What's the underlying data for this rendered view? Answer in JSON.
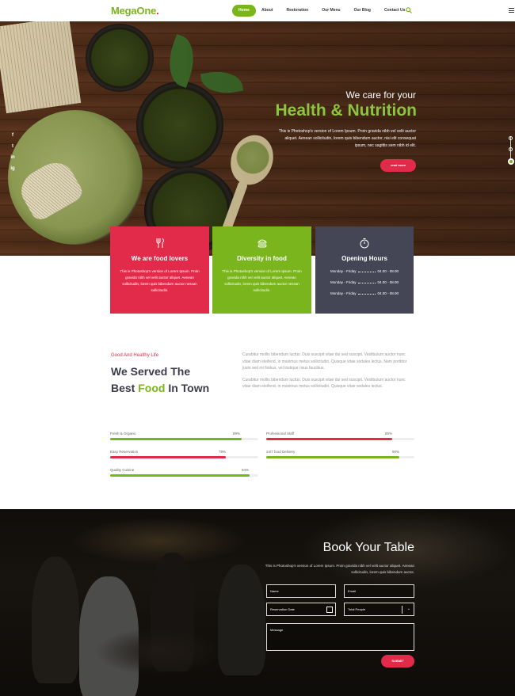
{
  "nav": {
    "logo": "MegaOne",
    "logo_dot": ".",
    "items": [
      "Home",
      "About",
      "Restoration",
      "Our Menu",
      "Our Blog",
      "Contact Us"
    ]
  },
  "hero": {
    "subtitle": "We care for your",
    "title": "Health & Nutrition",
    "description": "This is Photoshop's version of Lorem Ipsum. Proin gravida nibh vel velit auctor aliquet. Aenean sollicitudin, lorem quis bibendum auctor, nisi elit consequat ipsum, nec sagittis sem nibh id elit.",
    "button": "read more",
    "social": [
      "f",
      "t",
      "in",
      "ig"
    ]
  },
  "cards": [
    {
      "title": "We are food lovers",
      "text": "This is Photoshop's version of Lorem Ipsum. Proin gravida nibh vel velit auctor aliquet. Aenean sollicitudin, lorem quis bibendum auctor nessan sollicitudin.",
      "icon": "utensils-icon"
    },
    {
      "title": "Diversity in food",
      "text": "This is Photoshop's version of Lorem Ipsum. Proin gravida nibh vel velit auctor aliquet. Aenean sollicitudin, lorem quis bibendum auctor nessan sollicitudin.",
      "icon": "burger-icon"
    },
    {
      "title": "Opening Hours",
      "icon": "stopwatch-icon",
      "hours": [
        {
          "day": "Monday - Friday",
          "time": "04.00 - 08.00"
        },
        {
          "day": "Monday - Friday",
          "time": "04.00 - 08.00"
        },
        {
          "day": "Monday - Friday",
          "time": "04.00 - 08.00"
        }
      ]
    }
  ],
  "about": {
    "kicker": "Good And Healthy Life",
    "title_line1": "We Served The",
    "title_pre": "Best ",
    "title_highlight": "Food",
    "title_post": " In Town",
    "paragraphs": [
      "Curabitur mollis bibendum luctus. Duis suscipit vitae dui sed suscipit. Vestibulum auctor nunc vitae diam eleifend, in maximus metus sollicitudin. Quisque vitae sodales lectus. Nam porttitor justo sed mi finibus, vel tristique risus faucibus.",
      "Curabitur mollis bibendum luctus. Duis suscipit vitae dui sed suscipit. Vestibulum auctor nunc vitae diam eleifend, in maximus metus sollicitudin. Quisque vitae sodales lectus."
    ]
  },
  "skills": [
    {
      "label": "Fresh & Organic",
      "value": 89,
      "color": "#7ab51d"
    },
    {
      "label": "Professional Staff",
      "value": 85,
      "color": "#e22b4a"
    },
    {
      "label": "Easy Reservation",
      "value": 78,
      "color": "#e22b4a"
    },
    {
      "label": "24/7 food Delivery",
      "value": 90,
      "color": "#7ab51d"
    },
    {
      "label": "Quality Cuisine",
      "value": 94,
      "color": "#7ab51d"
    }
  ],
  "skill_pcts": [
    "89%",
    "85%",
    "78%",
    "90%",
    "94%"
  ],
  "booking": {
    "title": "Book Your Table",
    "description": "This is Photoshop's version of Lorem Ipsum. Proin gravida nibh vel velit auctor aliquet. Aenean sollicitudin, lorem quis bibendum auctor.",
    "name": "Name",
    "email": "Email",
    "date": "Reservation Date",
    "people": "Total People",
    "message": "Message",
    "submit": "SUBMIT"
  },
  "colors": {
    "green": "#7ab51d",
    "red": "#e22b4a",
    "dark": "#454655"
  }
}
